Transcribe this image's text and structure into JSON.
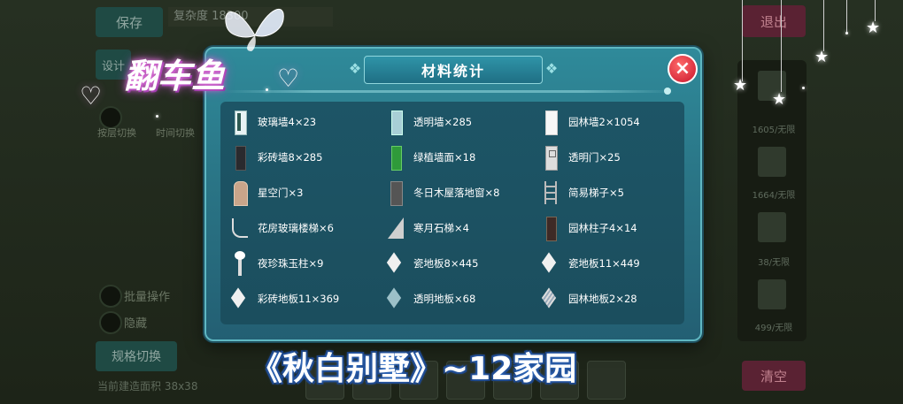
{
  "background": {
    "save_label": "保存",
    "design_label": "设计",
    "name_text": "复杂度 18300",
    "exit_label": "退出",
    "clear_label": "清空",
    "switch_label": "规格切换",
    "batch_label": "批量操作",
    "hide_label": "隐藏",
    "area_text": "当前建造面积 38x38",
    "side_counts": [
      "1605/无限",
      "1664/无限",
      "38/无限",
      "499/无限"
    ],
    "left_labels": [
      "按层切换",
      "时间切换"
    ]
  },
  "modal": {
    "title": "材料统计",
    "close_icon": "×",
    "materials": [
      {
        "label": "玻璃墙4×23",
        "icon": "glass"
      },
      {
        "label": "透明墙×285",
        "icon": "clear"
      },
      {
        "label": "园林墙2×1054",
        "icon": "white"
      },
      {
        "label": "彩砖墙8×285",
        "icon": "dark"
      },
      {
        "label": "绿植墙面×18",
        "icon": "green"
      },
      {
        "label": "透明门×25",
        "icon": "door"
      },
      {
        "label": "星空门×3",
        "icon": "door2"
      },
      {
        "label": "冬日木屋落地窗×8",
        "icon": "window"
      },
      {
        "label": "简易梯子×5",
        "icon": "ladder"
      },
      {
        "label": "花房玻璃楼梯×6",
        "icon": "stair"
      },
      {
        "label": "寒月石梯×4",
        "icon": "stair2"
      },
      {
        "label": "园林柱子4×14",
        "icon": "pillar"
      },
      {
        "label": "夜珍珠玉柱×9",
        "icon": "lamp"
      },
      {
        "label": "瓷地板8×445",
        "icon": "tile"
      },
      {
        "label": "瓷地板11×449",
        "icon": "tile"
      },
      {
        "label": "彩砖地板11×369",
        "icon": "tile"
      },
      {
        "label": "透明地板×68",
        "icon": "tile-blue"
      },
      {
        "label": "园林地板2×28",
        "icon": "tile-grid"
      }
    ]
  },
  "overlay": {
    "title": "翻车鱼",
    "caption": "《秋白别墅》~12家园"
  }
}
